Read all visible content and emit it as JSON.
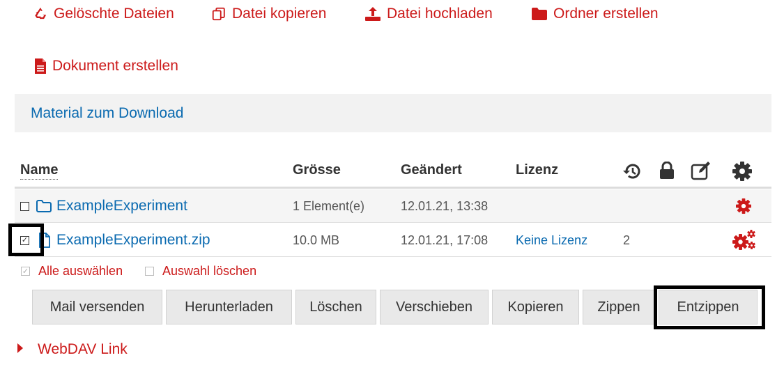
{
  "actions": {
    "deleted_files": "Gelöschte Dateien",
    "copy_file": "Datei kopieren",
    "upload_file": "Datei hochladen",
    "create_folder": "Ordner erstellen",
    "create_document": "Dokument erstellen"
  },
  "breadcrumb": "Material zum Download",
  "table": {
    "headers": {
      "name": "Name",
      "size": "Grösse",
      "modified": "Geändert",
      "license": "Lizenz"
    },
    "header_icons": [
      "history-icon",
      "lock-icon",
      "edit-icon",
      "gear-icon"
    ],
    "rows": [
      {
        "checked": false,
        "type": "folder",
        "name": "ExampleExperiment",
        "size": "1 Element(e)",
        "modified": "12.01.21, 13:38",
        "license": "",
        "versions": ""
      },
      {
        "checked": true,
        "type": "file",
        "name": "ExampleExperiment.zip",
        "size": "10.0 MB",
        "modified": "12.01.21, 17:08",
        "license": "Keine Lizenz",
        "versions": "2"
      }
    ]
  },
  "selection": {
    "select_all": "Alle auswählen",
    "clear_selection": "Auswahl löschen"
  },
  "buttons": {
    "mail": "Mail versenden",
    "download": "Herunterladen",
    "delete": "Löschen",
    "move": "Verschieben",
    "copy": "Kopieren",
    "zip": "Zippen",
    "unzip": "Entzippen"
  },
  "webdav": "WebDAV Link",
  "colors": {
    "accent_red": "#cc1a1a",
    "link_blue": "#0a6ab0"
  }
}
